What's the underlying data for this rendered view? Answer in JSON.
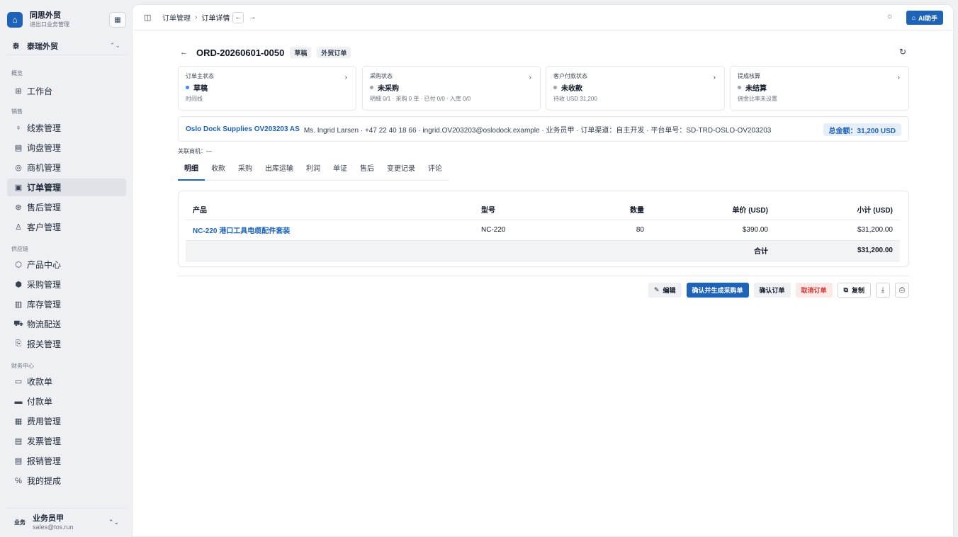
{
  "brand": {
    "logo": "⌂",
    "name": "同思外贸",
    "subtitle": "进出口业务管理",
    "grid_icon": "▦"
  },
  "company": {
    "badge": "泰",
    "name": "泰瑞外贸",
    "chevron": "⌃⌄"
  },
  "nav_groups": {
    "overview": "概览",
    "sales": "销售",
    "supply": "供应链",
    "finance": "财务中心"
  },
  "nav": {
    "workbench": {
      "icon": "⊞",
      "label": "工作台"
    },
    "leads": {
      "icon": "♀",
      "label": "线索管理"
    },
    "inquiry": {
      "icon": "▤",
      "label": "询盘管理"
    },
    "opportunity": {
      "icon": "◎",
      "label": "商机管理"
    },
    "orders": {
      "icon": "▣",
      "label": "订单管理"
    },
    "aftersales": {
      "icon": "⊛",
      "label": "售后管理"
    },
    "customers": {
      "icon": "♙",
      "label": "客户管理"
    },
    "products": {
      "icon": "⬡",
      "label": "产品中心"
    },
    "purchase": {
      "icon": "⬢",
      "label": "采购管理"
    },
    "inventory": {
      "icon": "▥",
      "label": "库存管理"
    },
    "logistics": {
      "icon": "⛟",
      "label": "物流配送"
    },
    "customs": {
      "icon": "⎘",
      "label": "报关管理"
    },
    "receipts": {
      "icon": "▭",
      "label": "收款单"
    },
    "payments": {
      "icon": "▬",
      "label": "付款单"
    },
    "expenses": {
      "icon": "▦",
      "label": "费用管理"
    },
    "invoices": {
      "icon": "▤",
      "label": "发票管理"
    },
    "reimburse": {
      "icon": "▤",
      "label": "报销管理"
    },
    "commission": {
      "icon": "℅",
      "label": "我的提成"
    }
  },
  "user": {
    "badge": "业务",
    "name": "业务员甲",
    "email": "sales@tos.run",
    "chevron": "⌃⌄"
  },
  "topbar": {
    "panel_icon": "◫",
    "crumb_parent": "订单管理",
    "crumb_sep": "›",
    "crumb_current": "订单详情",
    "back": "←",
    "forward": "→",
    "bug_icon": "☼",
    "ai_icon": "⌂",
    "ai_label": "AI助手"
  },
  "order": {
    "back": "←",
    "number": "ORD-20260601-0050",
    "tag_status": "草稿",
    "tag_type": "外贸订单",
    "refresh_icon": "↻"
  },
  "status_cards": {
    "main": {
      "label": "订单主状态",
      "value": "草稿",
      "sub": "时间线",
      "dot_color": "#3b82f6",
      "chev": "›"
    },
    "purchase": {
      "label": "采购状态",
      "value": "未采购",
      "sub": "明细 0/1 · 采购 0 单 · 已付 0/0 · 入库 0/0",
      "dot_color": "#9ca3af",
      "chev": "›"
    },
    "payment": {
      "label": "客户付款状态",
      "value": "未收款",
      "sub": "待收 USD 31,200",
      "dot_color": "#9ca3af",
      "chev": "›"
    },
    "commission": {
      "label": "提成核算",
      "value": "未结算",
      "sub": "佣金比率未设置",
      "dot_color": "#9ca3af",
      "chev": "›"
    }
  },
  "customer": {
    "name": "Oslo Dock Supplies OV203203 AS",
    "details": "Ms. Ingrid Larsen · +47 22 40 18 66 · ingrid.OV203203@oslodock.example · 业务员甲 · 订单渠道：自主开发 · 平台单号：SD-TRD-OSLO-OV203203",
    "total": "总金额：31,200 USD"
  },
  "assoc_label": "关联商机：—",
  "tabs": [
    "明细",
    "收款",
    "采购",
    "出库运输",
    "利润",
    "单证",
    "售后",
    "变更记录",
    "评论"
  ],
  "table": {
    "headers": {
      "product": "产品",
      "model": "型号",
      "qty": "数量",
      "price": "单价 (USD)",
      "subtotal": "小计 (USD)"
    },
    "rows": [
      {
        "product": "NC-220 港口工具电缆配件套装",
        "model": "NC-220",
        "qty": "80",
        "price": "$390.00",
        "subtotal": "$31,200.00"
      }
    ],
    "total_label": "合计",
    "total_value": "$31,200.00"
  },
  "actions": {
    "edit_icon": "✎",
    "edit": "编辑",
    "confirm_purchase": "确认并生成采购单",
    "confirm": "确认订单",
    "cancel": "取消订单",
    "copy_icon": "⧉",
    "copy": "复制",
    "download_icon": "⤓",
    "print_icon": "⎙"
  },
  "colors": {
    "accent": "#1d63b8",
    "danger": "#d32f2f",
    "sidebar_bg": "#eef0f3"
  }
}
